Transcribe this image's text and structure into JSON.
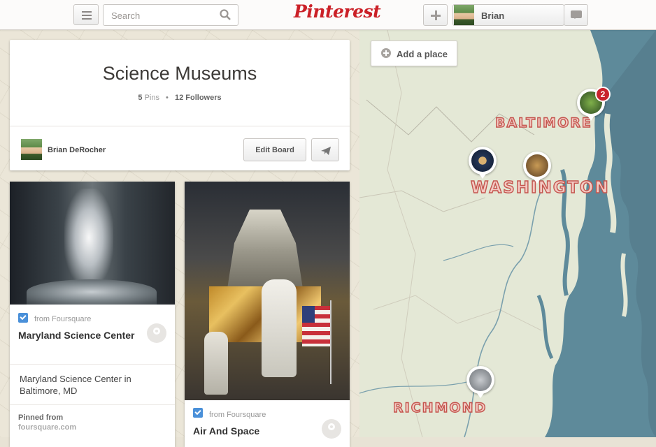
{
  "topbar": {
    "search_placeholder": "Search",
    "logo_text": "Pinterest",
    "user_name": "Brian"
  },
  "board": {
    "title": "Science Museums",
    "pins_count": "5",
    "pins_label": "Pins",
    "followers_count": "12",
    "followers_label": "Followers",
    "owner_name": "Brian DeRocher",
    "edit_label": "Edit Board"
  },
  "pins": [
    {
      "source_label": "from Foursquare",
      "title": "Maryland Science Center",
      "description": "Maryland Science Center in Baltimore, MD",
      "pinned_from_label": "Pinned from",
      "pinned_from_source": "foursquare.com"
    },
    {
      "source_label": "from Foursquare",
      "title": "Air And Space"
    }
  ],
  "map": {
    "add_place_label": "Add a place",
    "cities": [
      "BALTIMORE",
      "WASHINGTON",
      "RICHMOND"
    ],
    "cluster_count": "2",
    "colors": {
      "water": "#5e8a9a",
      "land": "#e4e8d6",
      "city_fill": "#f3c9c2",
      "city_stroke": "#c4554e",
      "badge": "#c8232c"
    }
  },
  "colors": {
    "brand": "#cb2027"
  }
}
